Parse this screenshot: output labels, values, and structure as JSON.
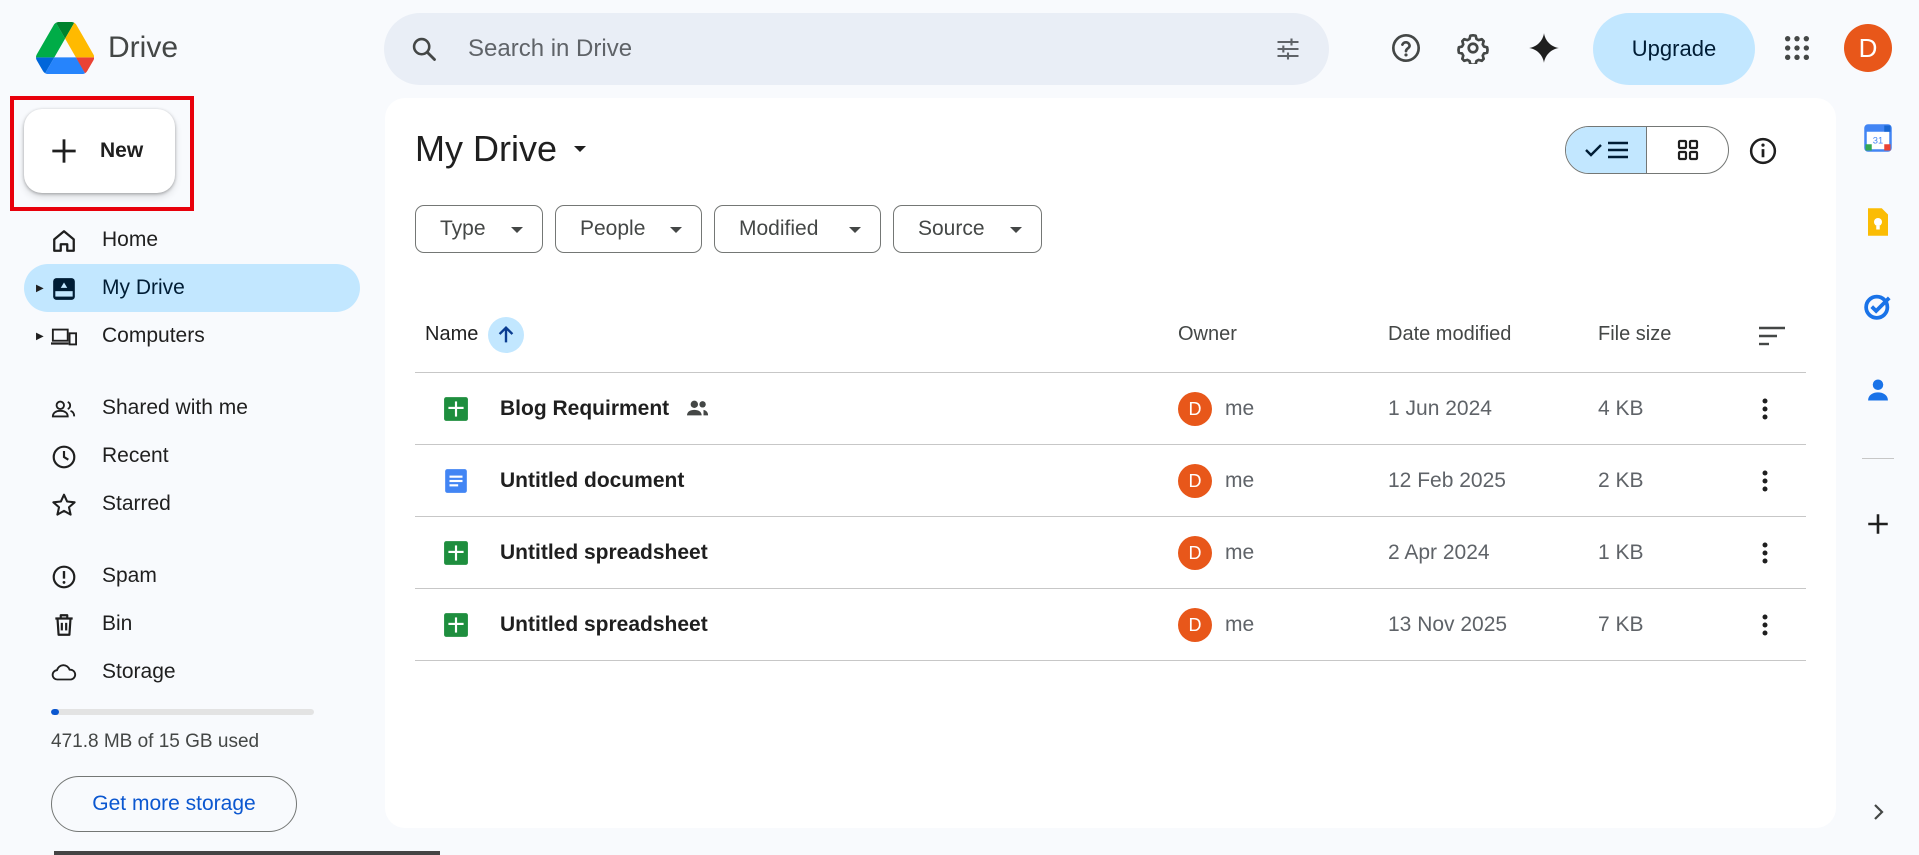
{
  "app": {
    "name": "Drive"
  },
  "search": {
    "placeholder": "Search in Drive"
  },
  "header": {
    "upgrade_label": "Upgrade",
    "avatar_letter": "D"
  },
  "sidebar": {
    "new_label": "New",
    "items": [
      {
        "label": "Home",
        "icon": "home-icon"
      },
      {
        "label": "My Drive",
        "icon": "my-drive-icon"
      },
      {
        "label": "Computers",
        "icon": "computers-icon"
      },
      {
        "label": "Shared with me",
        "icon": "shared-icon"
      },
      {
        "label": "Recent",
        "icon": "clock-icon"
      },
      {
        "label": "Starred",
        "icon": "star-icon"
      },
      {
        "label": "Spam",
        "icon": "spam-icon"
      },
      {
        "label": "Bin",
        "icon": "bin-icon"
      },
      {
        "label": "Storage",
        "icon": "cloud-icon"
      }
    ],
    "storage_text": "471.8 MB of 15 GB used",
    "storage_used_fraction": 0.031,
    "more_storage_label": "Get more storage"
  },
  "main": {
    "title": "My Drive",
    "filters": [
      "Type",
      "People",
      "Modified",
      "Source"
    ],
    "columns": {
      "name": "Name",
      "owner": "Owner",
      "date": "Date modified",
      "size": "File size"
    },
    "rows": [
      {
        "name": "Blog Requirment",
        "type": "spreadsheet",
        "shared": true,
        "owner_letter": "D",
        "owner": "me",
        "date": "1 Jun 2024",
        "size": "4 KB"
      },
      {
        "name": "Untitled document",
        "type": "document",
        "shared": false,
        "owner_letter": "D",
        "owner": "me",
        "date": "12 Feb 2025",
        "size": "2 KB"
      },
      {
        "name": "Untitled spreadsheet",
        "type": "spreadsheet",
        "shared": false,
        "owner_letter": "D",
        "owner": "me",
        "date": "2 Apr 2024",
        "size": "1 KB"
      },
      {
        "name": "Untitled spreadsheet",
        "type": "spreadsheet",
        "shared": false,
        "owner_letter": "D",
        "owner": "me",
        "date": "13 Nov 2025",
        "size": "7 KB"
      }
    ]
  },
  "colors": {
    "accent": "#0b57d0",
    "selected": "#c2e7ff",
    "sheets": "#1e8e3e",
    "docs": "#4285f4",
    "avatar": "#e8571a",
    "highlight_box": "#e8000b"
  }
}
